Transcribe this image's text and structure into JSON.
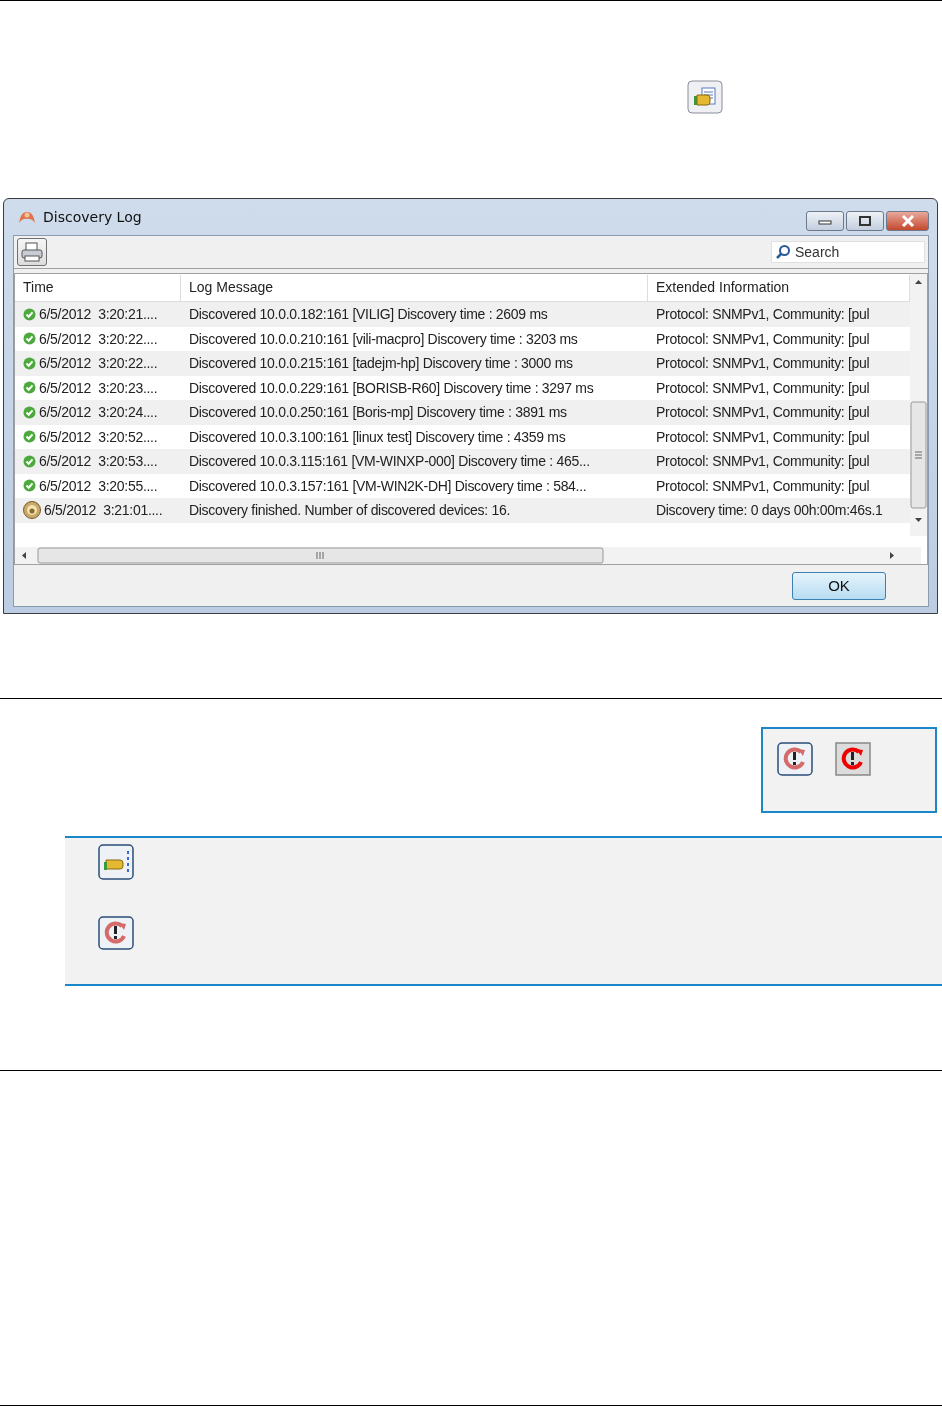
{
  "window": {
    "title": "Discovery Log",
    "search": {
      "placeholder": "Search"
    },
    "table": {
      "columns": [
        "Time",
        "Log Message",
        "Extended Information"
      ],
      "rows": [
        {
          "kind": "ok",
          "time": "6/5/2012  3:20:21....",
          "message": "Discovered 10.0.0.182:161 [VILIG]  Discovery time : 2609 ms",
          "extended": "Protocol: SNMPv1, Community: [pul"
        },
        {
          "kind": "ok",
          "time": "6/5/2012  3:20:22....",
          "message": "Discovered 10.0.0.210:161 [vili-macpro]  Discovery time : 3203 ms",
          "extended": "Protocol: SNMPv1, Community: [pul"
        },
        {
          "kind": "ok",
          "time": "6/5/2012  3:20:22....",
          "message": "Discovered 10.0.0.215:161 [tadejm-hp]  Discovery time : 3000 ms",
          "extended": "Protocol: SNMPv1, Community: [pul"
        },
        {
          "kind": "ok",
          "time": "6/5/2012  3:20:23....",
          "message": "Discovered 10.0.0.229:161 [BORISB-R60]  Discovery time : 3297 ms",
          "extended": "Protocol: SNMPv1, Community: [pul"
        },
        {
          "kind": "ok",
          "time": "6/5/2012  3:20:24....",
          "message": "Discovered 10.0.0.250:161 [Boris-mp]  Discovery time : 3891 ms",
          "extended": "Protocol: SNMPv1, Community: [pul"
        },
        {
          "kind": "ok",
          "time": "6/5/2012  3:20:52....",
          "message": "Discovered 10.0.3.100:161 [linux test]  Discovery time : 4359 ms",
          "extended": "Protocol: SNMPv1, Community: [pul"
        },
        {
          "kind": "ok",
          "time": "6/5/2012  3:20:53....",
          "message": "Discovered 10.0.3.115:161 [VM-WINXP-000]  Discovery time : 465...",
          "extended": "Protocol: SNMPv1, Community: [pul"
        },
        {
          "kind": "ok",
          "time": "6/5/2012  3:20:55....",
          "message": "Discovered 10.0.3.157:161 [VM-WIN2K-DH]  Discovery time : 584...",
          "extended": "Protocol: SNMPv1, Community: [pul"
        },
        {
          "kind": "done",
          "time": "6/5/2012  3:21:01....",
          "message": "Discovery finished. Number of discovered devices: 16.",
          "extended": "Discovery time: 0 days 00h:00m:46s.1"
        }
      ]
    },
    "ok_button": "OK"
  }
}
